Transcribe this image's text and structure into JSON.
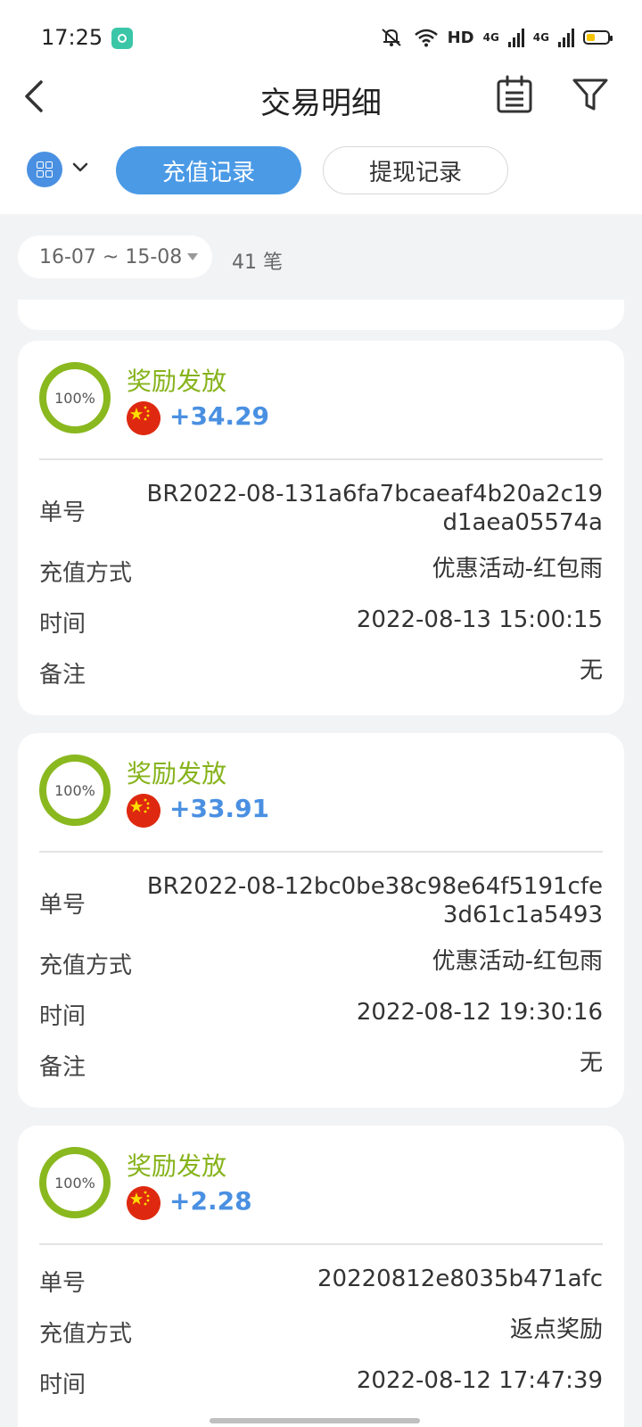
{
  "status_bar": {
    "time": "17:25",
    "hd_label": "HD",
    "net1": "4G",
    "net2": "4G"
  },
  "header": {
    "title": "交易明细"
  },
  "tabs": [
    {
      "label": "充值记录",
      "active": true
    },
    {
      "label": "提现记录",
      "active": false
    }
  ],
  "filter": {
    "date_range": "16-07 ~ 15-08",
    "count": "41 笔"
  },
  "field_labels": {
    "order_no": "单号",
    "method": "充值方式",
    "time": "时间",
    "remark": "备注"
  },
  "records": [
    {
      "progress_label": "100%",
      "status": "奖励发放",
      "amount": "+34.29",
      "order_no": "BR2022-08-131a6fa7bcaeaf4b20a2c19d1aea05574a",
      "method": "优惠活动-红包雨",
      "time": "2022-08-13 15:00:15",
      "remark": "无"
    },
    {
      "progress_label": "100%",
      "status": "奖励发放",
      "amount": "+33.91",
      "order_no": "BR2022-08-12bc0be38c98e64f5191cfe3d61c1a5493",
      "method": "优惠活动-红包雨",
      "time": "2022-08-12 19:30:16",
      "remark": "无"
    },
    {
      "progress_label": "100%",
      "status": "奖励发放",
      "amount": "+2.28",
      "order_no": "20220812e8035b471afc",
      "method": "返点奖励",
      "time": "2022-08-12 17:47:39",
      "remark": ""
    }
  ],
  "colors": {
    "accent_blue": "#4a9ae6",
    "success_green": "#86b31b",
    "amount_blue": "#4a90e2"
  }
}
